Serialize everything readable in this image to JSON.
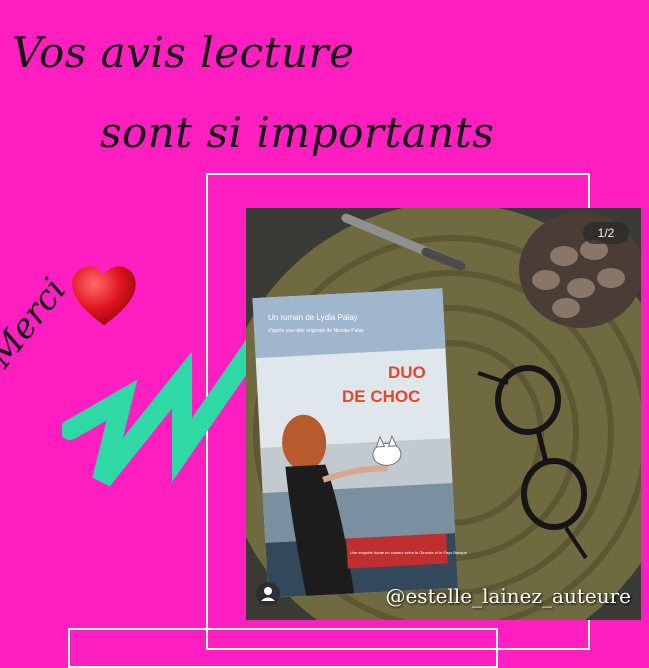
{
  "headline": {
    "line1": "Vos avis lecture",
    "line2": "sont si importants"
  },
  "side_text": "Merci",
  "photo": {
    "counter": "1/2",
    "handle": "@estelle_lainez_auteure",
    "book": {
      "author_line": "Un roman de Lydia Palay",
      "idea_line": "d'après une idée originale de Nicolas Palay",
      "title_line1": "DUO",
      "title_line2": "DE CHOC",
      "tagline": "Une enquête haute en couleur entre la Gironde et le Pays Basque"
    }
  },
  "icons": [
    "heart-icon",
    "person-icon"
  ],
  "colors": {
    "background": "#ff1fc0",
    "stripe": "#2fd9a5",
    "heart": "#e0141f",
    "title": "#e8452b"
  }
}
